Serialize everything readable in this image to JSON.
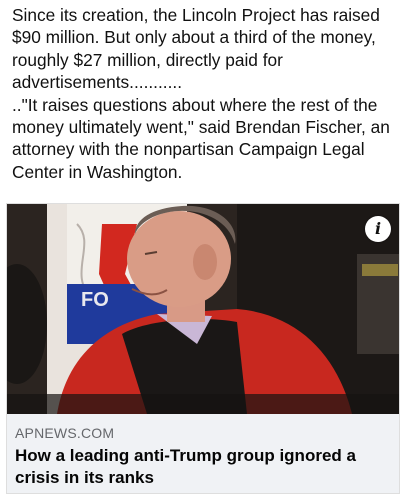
{
  "post": {
    "paragraph1": "Since its creation, the Lincoln Project has raised $90 million. But only about a third of the money, roughly $27 million, directly paid for advertisements...........",
    "paragraph2": "..\"It raises questions about where the rest of the money ultimately went,\" said Brendan Fischer, an attorney with the nonpartisan Campaign Legal Center in Washington."
  },
  "link_card": {
    "image_description_icon": "info-icon",
    "info_glyph": "i",
    "sign_text": "FO",
    "domain": "APNEWS.COM",
    "title": "How a leading anti-Trump group ignored a crisis in its ranks"
  },
  "colors": {
    "domain_gray": "#65676b",
    "card_background": "#f0f2f5",
    "jacket_red": "#c8281f"
  }
}
